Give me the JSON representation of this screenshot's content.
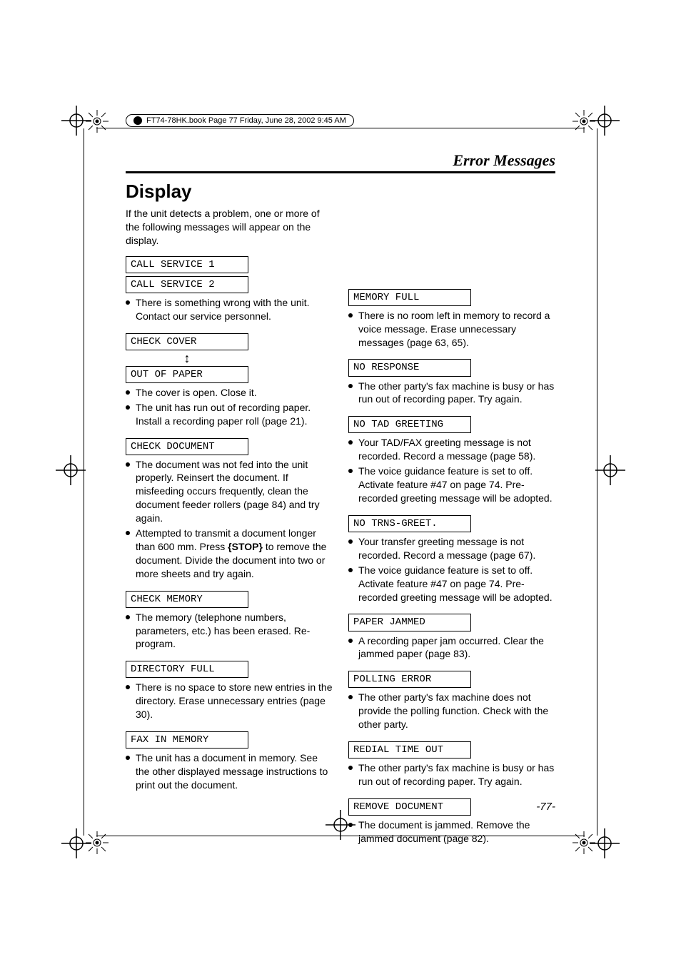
{
  "meta": {
    "book_header": "FT74-78HK.book  Page 77  Friday, June 28, 2002  9:45 AM",
    "section_label": "Error Messages",
    "page_number": "-77-"
  },
  "left": {
    "heading": "Display",
    "intro": "If the unit detects a problem, one or more of the following messages will appear on the display.",
    "blocks": [
      {
        "lcd": [
          "CALL SERVICE 1",
          "CALL SERVICE 2"
        ],
        "arrow_between": false,
        "bullets": [
          "There is something wrong with the unit. Contact our service personnel."
        ]
      },
      {
        "lcd": [
          "CHECK COVER",
          "OUT OF PAPER"
        ],
        "arrow_between": true,
        "bullets": [
          "The cover is open. Close it.",
          "The unit has run out of recording paper. Install a recording paper roll (page 21)."
        ]
      },
      {
        "lcd": [
          "CHECK DOCUMENT"
        ],
        "bullets": [
          "The document was not fed into the unit properly. Reinsert the document. If misfeeding occurs frequently, clean the document feeder rollers (page 84) and try again.",
          {
            "pre": "Attempted to transmit a document longer than 600 mm. Press ",
            "key": "{STOP}",
            "post": " to remove the document. Divide the document into two or more sheets and try again."
          }
        ]
      },
      {
        "lcd": [
          "CHECK MEMORY"
        ],
        "bullets": [
          "The memory (telephone numbers, parameters, etc.) has been erased. Re-program."
        ]
      },
      {
        "lcd": [
          "DIRECTORY FULL"
        ],
        "bullets": [
          "There is no space to store new entries in the directory. Erase unnecessary entries (page 30)."
        ]
      },
      {
        "lcd": [
          "FAX IN MEMORY"
        ],
        "bullets": [
          "The unit has a document in memory. See the other displayed message instructions to print out the document."
        ]
      }
    ]
  },
  "right": {
    "blocks": [
      {
        "lcd": [
          "MEMORY FULL"
        ],
        "bullets": [
          "There is no room left in memory to record a voice message. Erase unnecessary messages (page 63, 65)."
        ]
      },
      {
        "lcd": [
          "NO RESPONSE"
        ],
        "bullets": [
          "The other party's fax machine is busy or has run out of recording paper. Try again."
        ]
      },
      {
        "lcd": [
          "NO TAD GREETING"
        ],
        "bullets": [
          "Your TAD/FAX greeting message is not recorded. Record a message (page 58).",
          "The voice guidance feature is set to off. Activate feature #47 on page 74. Pre-recorded greeting message will be adopted."
        ]
      },
      {
        "lcd": [
          "NO TRNS-GREET."
        ],
        "bullets": [
          "Your transfer greeting message is not recorded. Record a message (page 67).",
          "The voice guidance feature is set to off. Activate feature #47 on page 74. Pre-recorded greeting message will be adopted."
        ]
      },
      {
        "lcd": [
          "PAPER JAMMED"
        ],
        "bullets": [
          "A recording paper jam occurred. Clear the jammed paper (page 83)."
        ]
      },
      {
        "lcd": [
          "POLLING ERROR"
        ],
        "bullets": [
          "The other party's fax machine does not provide the polling function. Check with the other party."
        ]
      },
      {
        "lcd": [
          "REDIAL TIME OUT"
        ],
        "bullets": [
          "The other party's fax machine is busy or has run out of recording paper. Try again."
        ]
      },
      {
        "lcd": [
          "REMOVE DOCUMENT"
        ],
        "bullets": [
          "The document is jammed. Remove the jammed document (page 82)."
        ]
      }
    ]
  }
}
